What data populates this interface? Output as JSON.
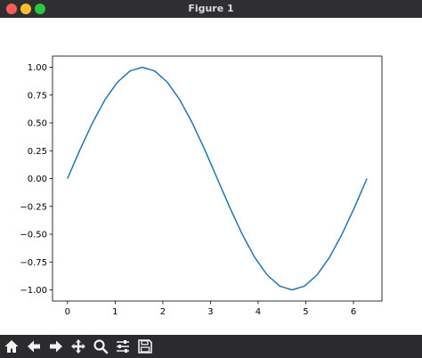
{
  "window": {
    "title": "Figure 1"
  },
  "toolbar": {
    "buttons": [
      {
        "name": "home",
        "icon": "home-icon"
      },
      {
        "name": "back",
        "icon": "arrow-left-icon"
      },
      {
        "name": "forward",
        "icon": "arrow-right-icon"
      },
      {
        "name": "pan",
        "icon": "move-icon"
      },
      {
        "name": "zoom",
        "icon": "magnifier-icon"
      },
      {
        "name": "configure-subplots",
        "icon": "sliders-icon"
      },
      {
        "name": "save",
        "icon": "floppy-disk-icon"
      }
    ]
  },
  "chart_data": {
    "type": "line",
    "title": "",
    "xlabel": "",
    "ylabel": "",
    "xlim": [
      -0.3142,
      6.5973
    ],
    "ylim": [
      -1.1,
      1.1
    ],
    "grid": false,
    "x_ticks": [
      0,
      1,
      2,
      3,
      4,
      5,
      6
    ],
    "x_tick_labels": [
      "0",
      "1",
      "2",
      "3",
      "4",
      "5",
      "6"
    ],
    "y_ticks": [
      1.0,
      0.75,
      0.5,
      0.25,
      0.0,
      -0.25,
      -0.5,
      -0.75,
      -1.0
    ],
    "y_tick_labels": [
      "1.00",
      "0.75",
      "0.50",
      "0.25",
      "0.00",
      "−0.25",
      "−0.50",
      "−0.75",
      "−1.00"
    ],
    "line_color": "#1f77b4",
    "series": [
      {
        "x": [
          0.0,
          0.2618,
          0.5236,
          0.7854,
          1.0472,
          1.309,
          1.5708,
          1.8326,
          2.0944,
          2.3562,
          2.618,
          2.8798,
          3.1416,
          3.4034,
          3.6652,
          3.927,
          4.1888,
          4.4506,
          4.7124,
          4.9742,
          5.236,
          5.4978,
          5.7596,
          6.0214,
          6.2832
        ],
        "y": [
          0.0,
          0.2588,
          0.5,
          0.7071,
          0.866,
          0.9659,
          1.0,
          0.9659,
          0.866,
          0.7071,
          0.5,
          0.2588,
          0.0,
          -0.2588,
          -0.5,
          -0.7071,
          -0.866,
          -0.9659,
          -1.0,
          -0.9659,
          -0.866,
          -0.7071,
          -0.5,
          -0.2588,
          0.0
        ]
      }
    ]
  }
}
